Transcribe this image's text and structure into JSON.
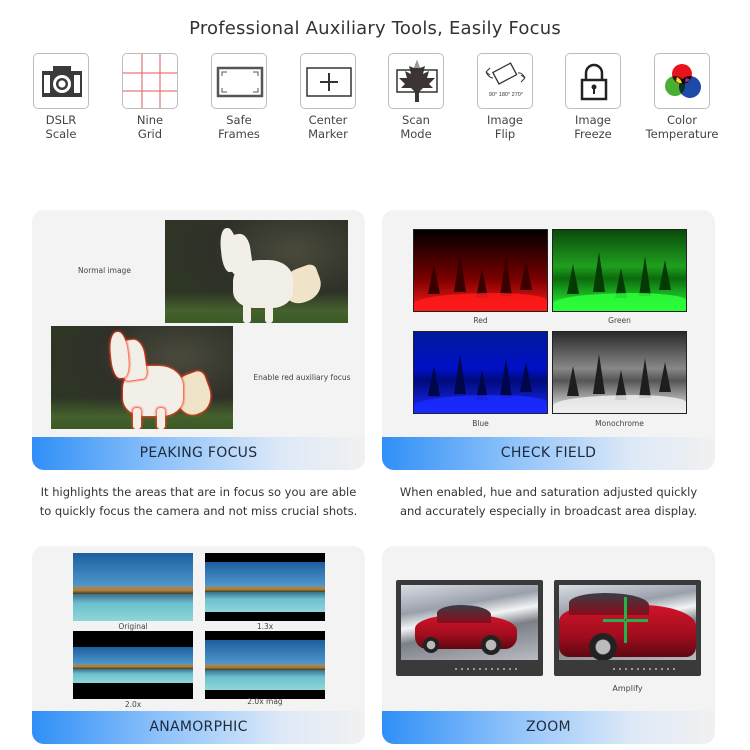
{
  "page": {
    "title": "Professional Auxiliary Tools, Easily Focus"
  },
  "tools": [
    {
      "icon": "camera-icon",
      "line1": "DSLR",
      "line2": "Scale"
    },
    {
      "icon": "nine-grid-icon",
      "line1": "Nine",
      "line2": "Grid"
    },
    {
      "icon": "safe-frames-icon",
      "line1": "Safe",
      "line2": "Frames"
    },
    {
      "icon": "center-marker-icon",
      "line1": "Center",
      "line2": "Marker"
    },
    {
      "icon": "maple-leaf-scan-icon",
      "line1": "Scan",
      "line2": "Mode"
    },
    {
      "icon": "rotate-flip-icon",
      "line1": "Image",
      "line2": "Flip",
      "sub": "90° 180° 270°"
    },
    {
      "icon": "padlock-icon",
      "line1": "Image",
      "line2": "Freeze"
    },
    {
      "icon": "rgb-circles-icon",
      "line1": "Color",
      "line2": "Temperature"
    }
  ],
  "cards": {
    "peaking": {
      "banner": "PEAKING FOCUS",
      "normal_caption": "Normal image",
      "enable_caption": "Enable red auxiliary focus",
      "desc_line1": "It highlights the areas that are in focus so you are able",
      "desc_line2": "to quickly focus the camera and not miss crucial shots."
    },
    "check_field": {
      "banner": "CHECK FIELD",
      "captions": [
        "Red",
        "Green",
        "Blue",
        "Monochrome"
      ],
      "desc_line1": "When enabled,  hue and saturation adjusted quickly",
      "desc_line2": "and accurately especially in broadcast area display."
    },
    "anamorphic": {
      "banner": "ANAMORPHIC",
      "captions": [
        "Original",
        "1.3x",
        "2.0x",
        "2.0x mag"
      ]
    },
    "zoom": {
      "banner": "ZOOM",
      "caption": "Amplify"
    }
  },
  "colors": {
    "banner_start": "#2f8ff7",
    "banner_end": "#f1f1f1",
    "card_bg": "#f3f3f3",
    "peaking_red": "#ff3a1a",
    "arrow_green": "#23b24b"
  }
}
